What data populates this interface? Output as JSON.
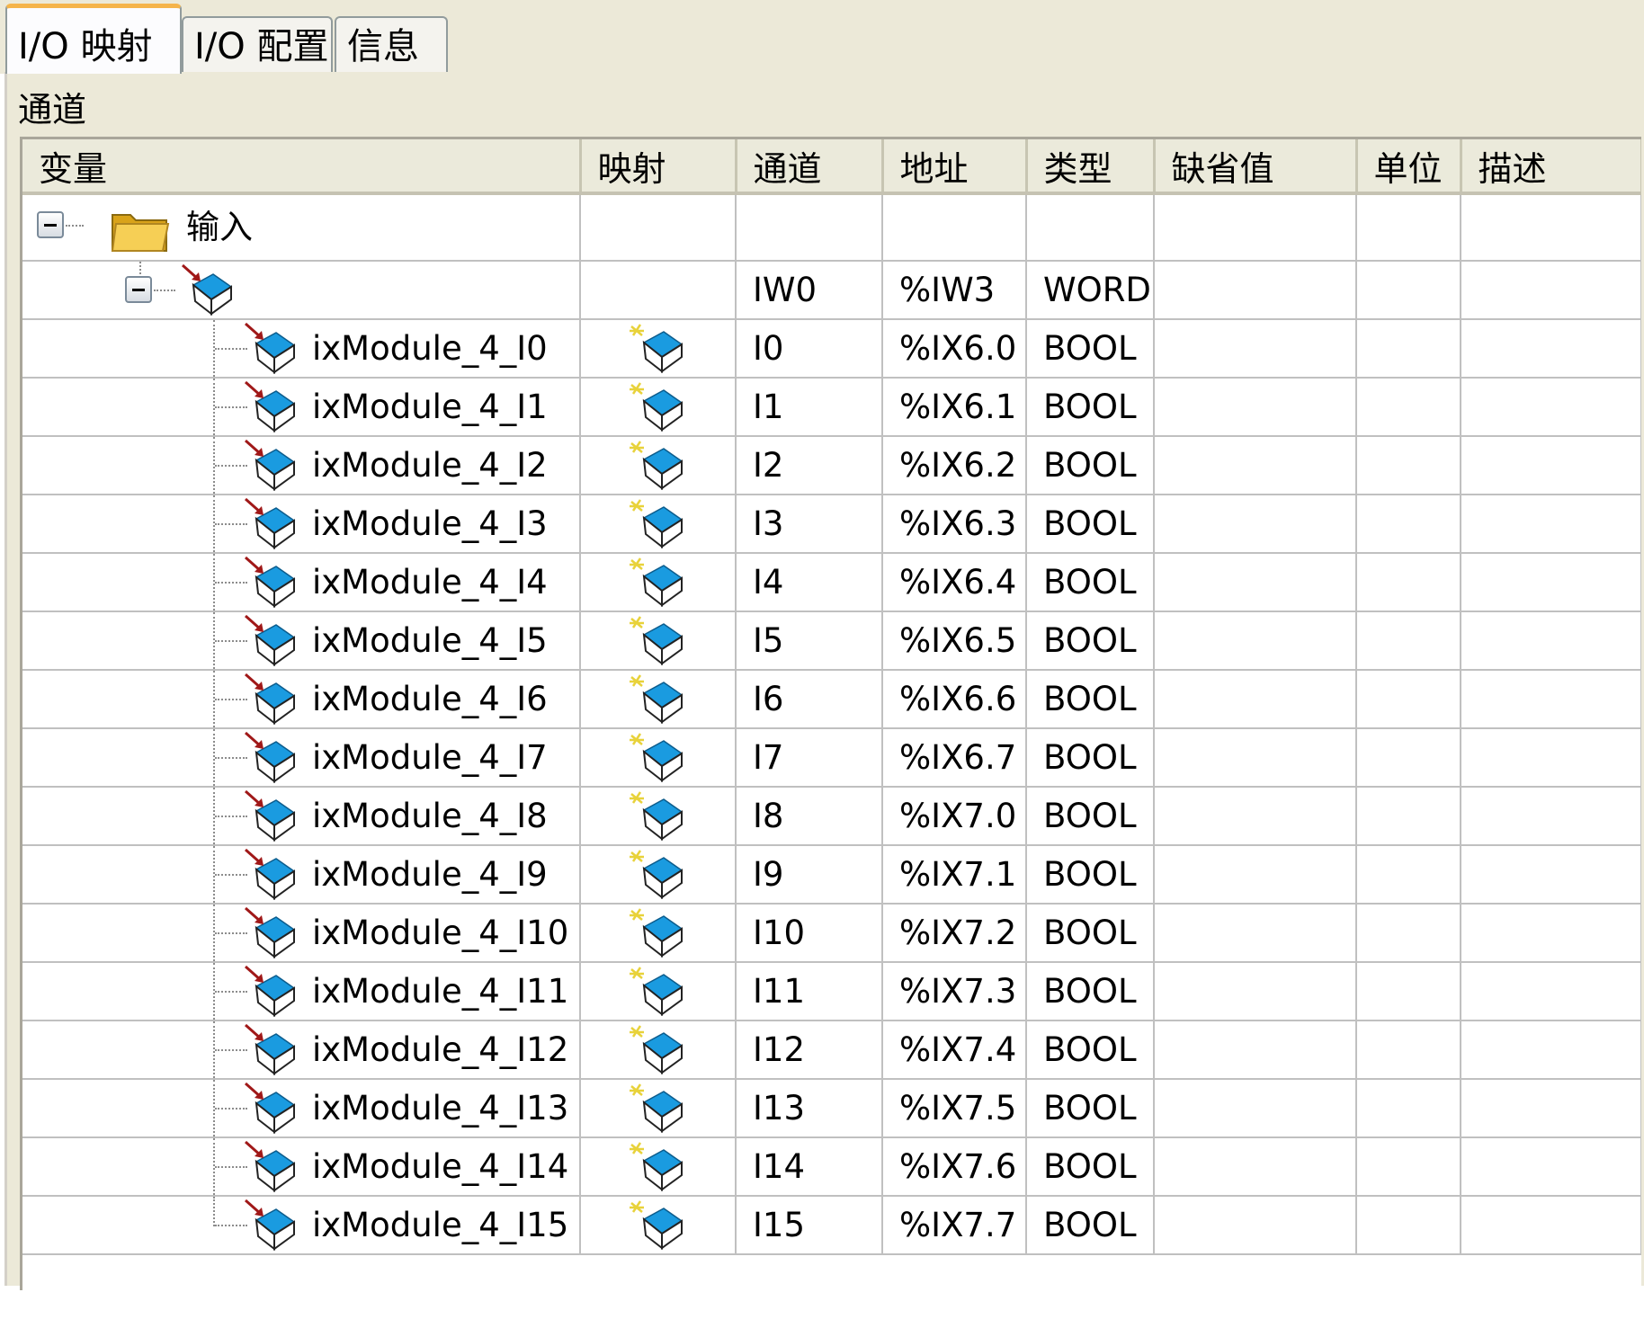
{
  "tabs": [
    {
      "label": "I/O 映射",
      "active": true
    },
    {
      "label": "I/O 配置",
      "active": false
    },
    {
      "label": "信息",
      "active": false
    }
  ],
  "group_label": "通道",
  "columns": [
    "变量",
    "映射",
    "通道",
    "地址",
    "类型",
    "缺省值",
    "单位",
    "描述"
  ],
  "tree": {
    "root_label": "输入",
    "word": {
      "variable": "",
      "channel": "IW0",
      "address": "%IW3",
      "type": "WORD"
    }
  },
  "rows": [
    {
      "variable": "ixModule_4_I0",
      "channel": "I0",
      "address": "%IX6.0",
      "type": "BOOL"
    },
    {
      "variable": "ixModule_4_I1",
      "channel": "I1",
      "address": "%IX6.1",
      "type": "BOOL"
    },
    {
      "variable": "ixModule_4_I2",
      "channel": "I2",
      "address": "%IX6.2",
      "type": "BOOL"
    },
    {
      "variable": "ixModule_4_I3",
      "channel": "I3",
      "address": "%IX6.3",
      "type": "BOOL"
    },
    {
      "variable": "ixModule_4_I4",
      "channel": "I4",
      "address": "%IX6.4",
      "type": "BOOL"
    },
    {
      "variable": "ixModule_4_I5",
      "channel": "I5",
      "address": "%IX6.5",
      "type": "BOOL"
    },
    {
      "variable": "ixModule_4_I6",
      "channel": "I6",
      "address": "%IX6.6",
      "type": "BOOL"
    },
    {
      "variable": "ixModule_4_I7",
      "channel": "I7",
      "address": "%IX6.7",
      "type": "BOOL"
    },
    {
      "variable": "ixModule_4_I8",
      "channel": "I8",
      "address": "%IX7.0",
      "type": "BOOL"
    },
    {
      "variable": "ixModule_4_I9",
      "channel": "I9",
      "address": "%IX7.1",
      "type": "BOOL"
    },
    {
      "variable": "ixModule_4_I10",
      "channel": "I10",
      "address": "%IX7.2",
      "type": "BOOL"
    },
    {
      "variable": "ixModule_4_I11",
      "channel": "I11",
      "address": "%IX7.3",
      "type": "BOOL"
    },
    {
      "variable": "ixModule_4_I12",
      "channel": "I12",
      "address": "%IX7.4",
      "type": "BOOL"
    },
    {
      "variable": "ixModule_4_I13",
      "channel": "I13",
      "address": "%IX7.5",
      "type": "BOOL"
    },
    {
      "variable": "ixModule_4_I14",
      "channel": "I14",
      "address": "%IX7.6",
      "type": "BOOL"
    },
    {
      "variable": "ixModule_4_I15",
      "channel": "I15",
      "address": "%IX7.7",
      "type": "BOOL"
    }
  ],
  "icons": {
    "collapse": "minus-box-icon",
    "folder": "folder-icon",
    "channel": "input-channel-icon",
    "mapping": "mapping-variable-icon"
  },
  "colors": {
    "active_tab_accent": "#f5b44a",
    "panel_background": "#ece9d8",
    "channel_icon_blue": "#1a9be0",
    "arrow_red": "#a01818"
  }
}
